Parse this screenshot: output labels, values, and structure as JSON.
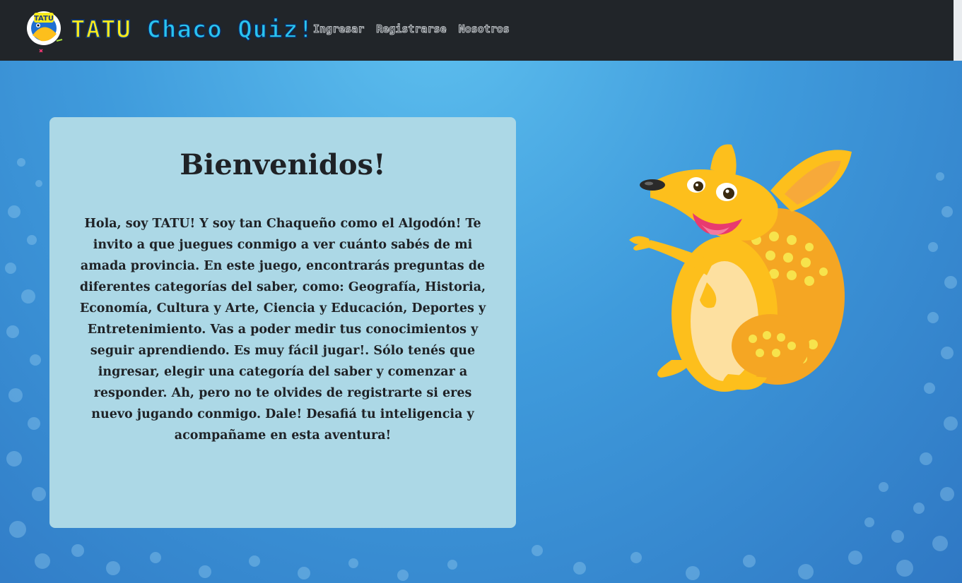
{
  "navbar": {
    "brand": {
      "title_part1": "TATU",
      "title_part2": "Chaco Quiz!",
      "logo_text": "TATU"
    },
    "links": [
      {
        "label": "Ingresar"
      },
      {
        "label": "Registrarse"
      },
      {
        "label": "Nosotros"
      }
    ]
  },
  "welcome": {
    "title": "Bienvenidos!",
    "text": "Hola, soy TATU! Y soy tan Chaqueño como el Algodón! Te invito a que juegues conmigo a ver cuánto sabés de mi amada provincia. En este juego, encontrarás preguntas de diferentes categorías del saber, como: Geografía, Historia, Economía, Cultura y Arte, Ciencia y Educación, Deportes y Entretenimiento. Vas a poder medir tus conocimientos y seguir aprendiendo. Es muy fácil jugar!. Sólo tenés que ingresar, elegir una categoría del saber y comenzar a responder. Ah, pero no te olvides de registrarte si eres nuevo jugando conmigo. Dale! Desafiá tu inteligencia y acompañame en esta aventura!"
  },
  "theme": {
    "navbar_bg": "#212529",
    "card_bg": "#acd8e6",
    "brand_yellow": "#f7ea1c",
    "brand_cyan": "#29c3f0",
    "mascot_body": "#fdbf1c"
  },
  "icons": {
    "logo": "tatu-logo-icon",
    "mascot": "armadillo-mascot"
  }
}
